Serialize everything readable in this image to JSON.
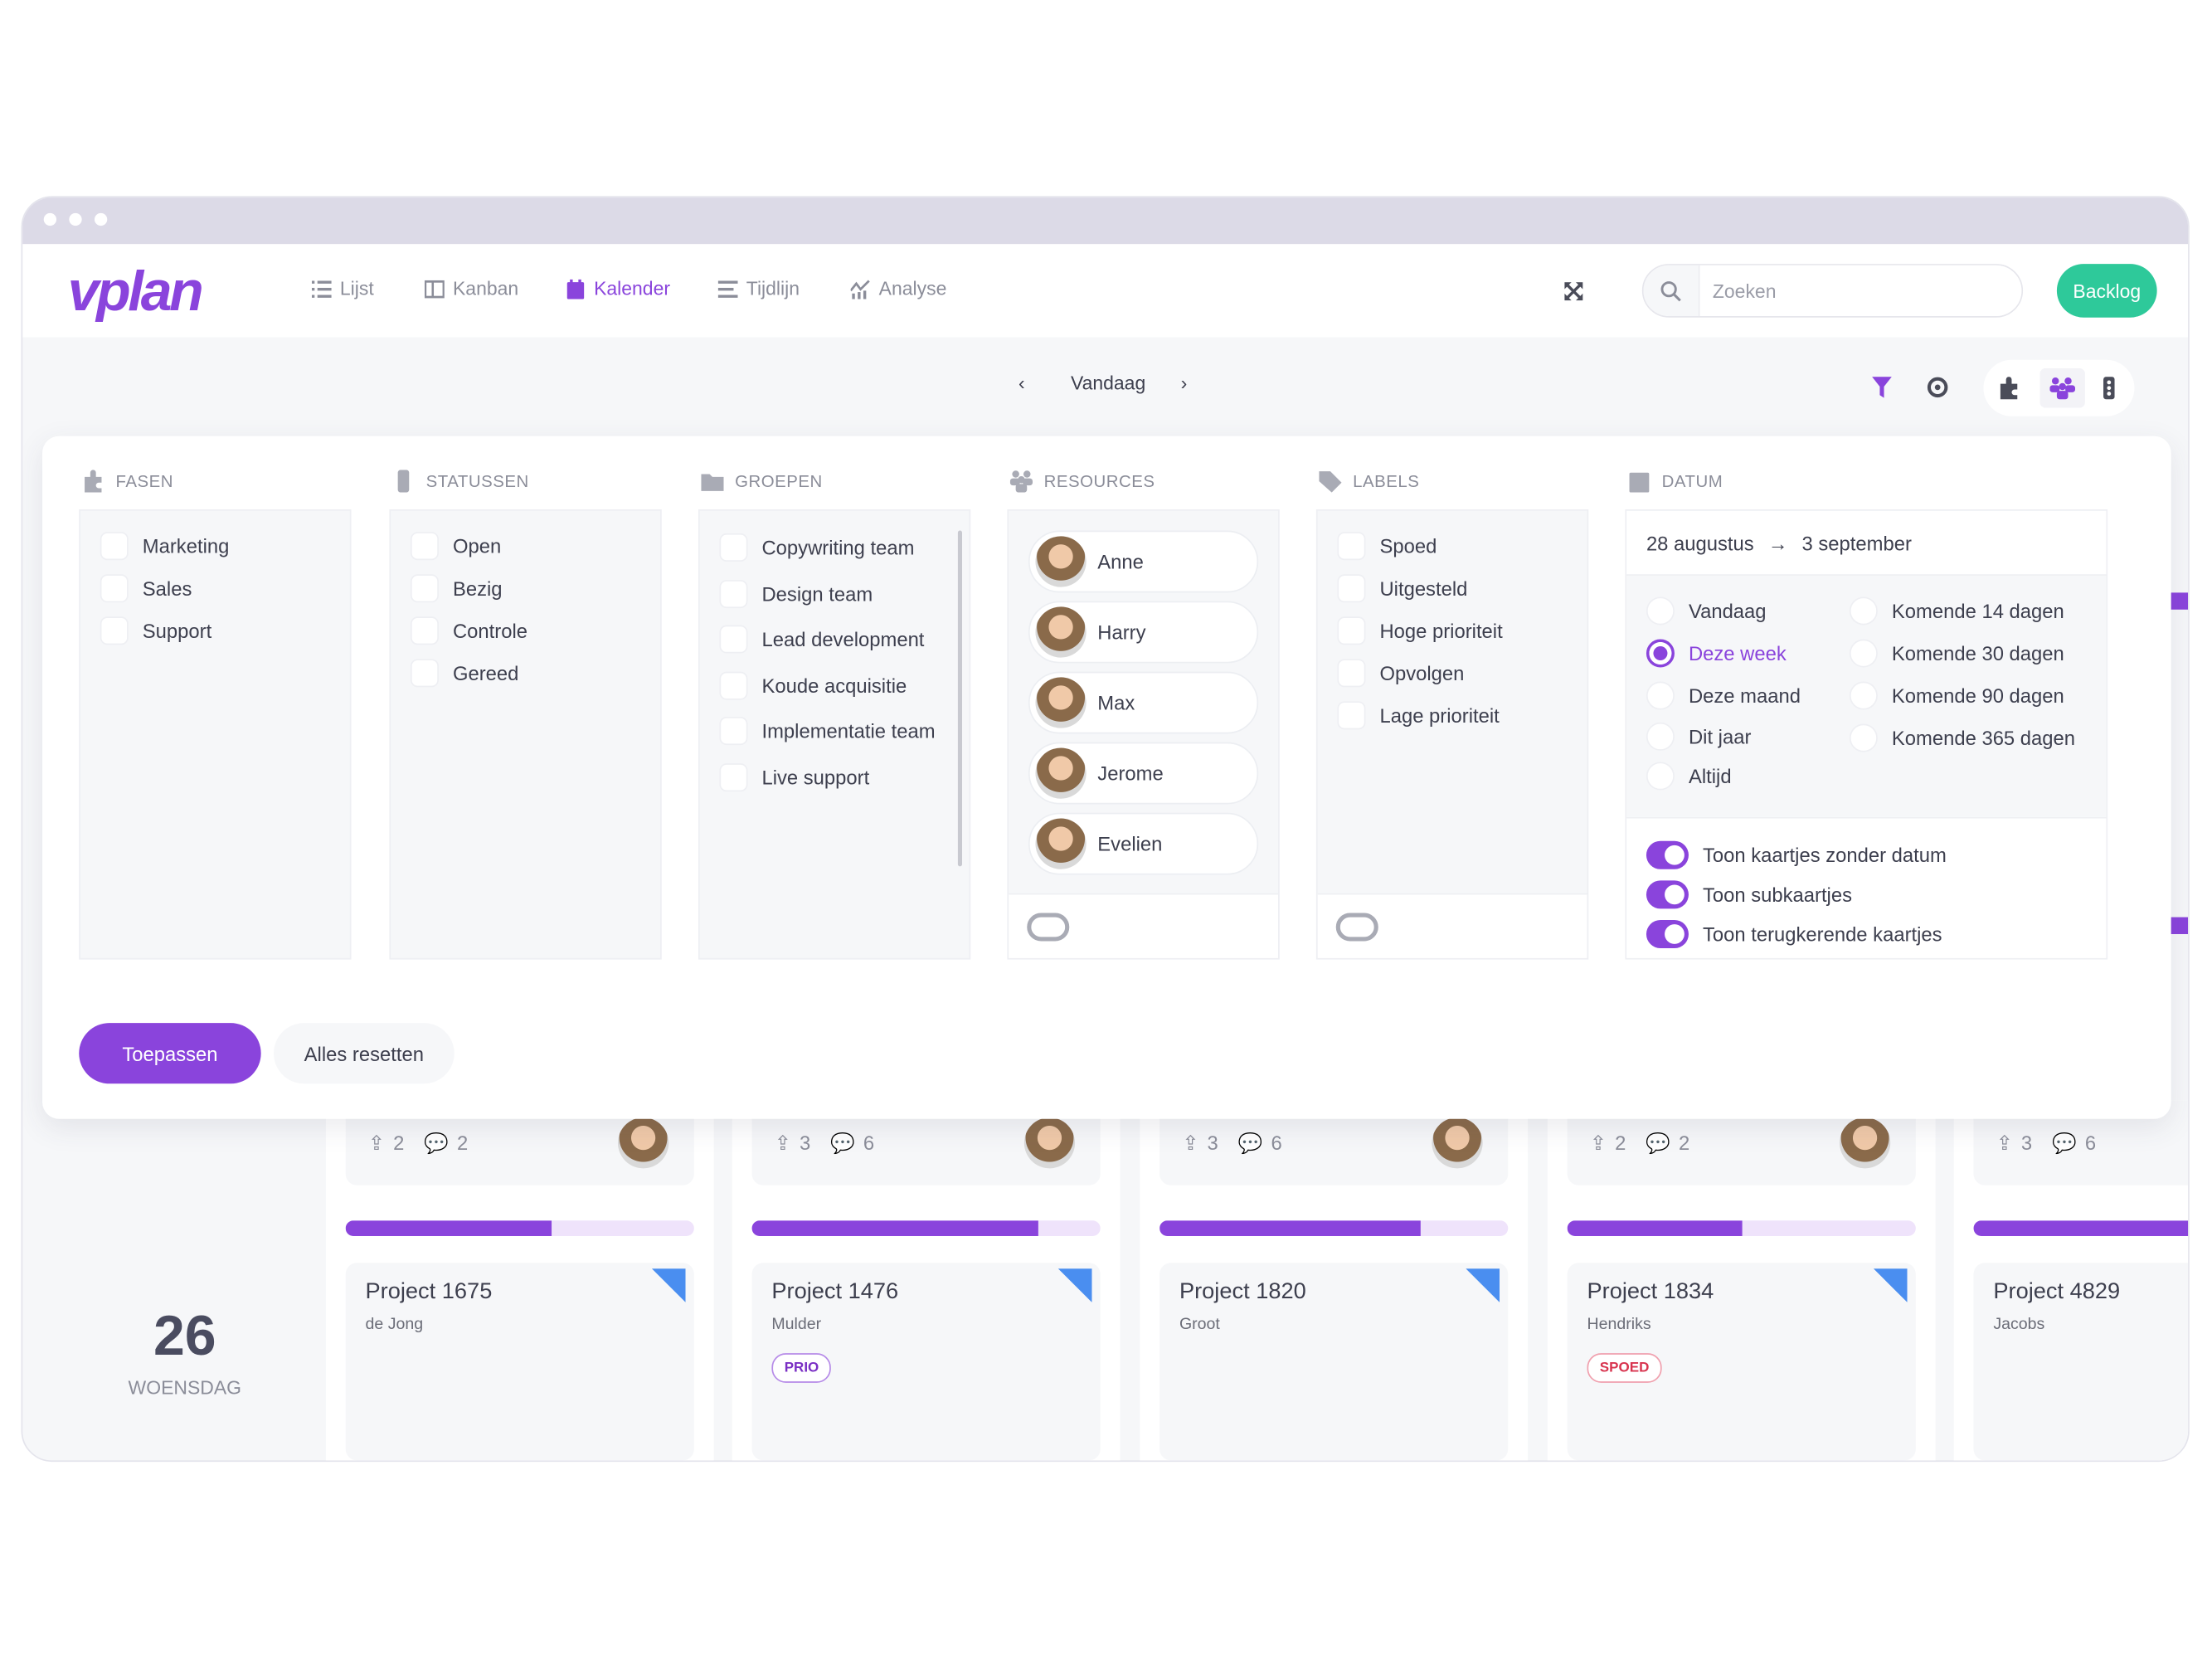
{
  "app": {
    "logo": "vplan"
  },
  "nav": [
    {
      "label": "Lijst",
      "icon": "list-icon"
    },
    {
      "label": "Kanban",
      "icon": "kanban-icon"
    },
    {
      "label": "Kalender",
      "icon": "calendar-icon",
      "active": true
    },
    {
      "label": "Tijdlijn",
      "icon": "timeline-icon"
    },
    {
      "label": "Analyse",
      "icon": "chart-icon"
    }
  ],
  "search": {
    "placeholder": "Zoeken",
    "value": ""
  },
  "backlog_label": "Backlog",
  "datenav": {
    "today": "Vandaag"
  },
  "colors": {
    "accent": "#8a44dc",
    "backlog": "#2ec99a",
    "flag": "#4a8ef0",
    "spoed": "#d8344f"
  },
  "filters": {
    "fasen": {
      "title": "FASEN",
      "items": [
        "Marketing",
        "Sales",
        "Support"
      ]
    },
    "statussen": {
      "title": "STATUSSEN",
      "items": [
        "Open",
        "Bezig",
        "Controle",
        "Gereed"
      ]
    },
    "groepen": {
      "title": "GROEPEN",
      "items": [
        "Copywriting team",
        "Design team",
        "Lead development",
        "Koude acquisitie",
        "Implementatie team",
        "Live support"
      ]
    },
    "resources": {
      "title": "RESOURCES",
      "items": [
        "Anne",
        "Harry",
        "Max",
        "Jerome",
        "Evelien"
      ],
      "toggle": false
    },
    "labels": {
      "title": "LABELS",
      "items": [
        "Spoed",
        "Uitgesteld",
        "Hoge prioriteit",
        "Opvolgen",
        "Lage prioriteit"
      ],
      "toggle": false
    },
    "datum": {
      "title": "DATUM",
      "from": "28 augustus",
      "arrow": "→",
      "to": "3 september",
      "options_left": [
        "Vandaag",
        "Deze week",
        "Deze maand",
        "Dit jaar",
        "Altijd"
      ],
      "options_right": [
        "Komende 14 dagen",
        "Komende 30 dagen",
        "Komende 90 dagen",
        "Komende 365 dagen"
      ],
      "selected": "Deze week",
      "toggles": [
        {
          "label": "Toon kaartjes zonder datum",
          "on": true
        },
        {
          "label": "Toon subkaartjes",
          "on": true
        },
        {
          "label": "Toon terugkerende kaartjes",
          "on": true
        }
      ]
    }
  },
  "actions": {
    "apply": "Toepassen",
    "reset": "Alles resetten"
  },
  "day": {
    "number": "26",
    "weekday": "WOENSDAG"
  },
  "cards": [
    {
      "uploads": "2",
      "comments": "2",
      "progress": 59,
      "title": "Project 1675",
      "client": "de Jong",
      "badge": "",
      "flag": true
    },
    {
      "uploads": "3",
      "comments": "6",
      "progress": 82,
      "title": "Project 1476",
      "client": "Mulder",
      "badge": "PRIO",
      "flag": true
    },
    {
      "uploads": "3",
      "comments": "6",
      "progress": 75,
      "title": "Project 1820",
      "client": "Groot",
      "badge": "",
      "flag": true
    },
    {
      "uploads": "2",
      "comments": "2",
      "progress": 50,
      "title": "Project 1834",
      "client": "Hendriks",
      "badge": "SPOED",
      "flag": true
    },
    {
      "uploads": "3",
      "comments": "6",
      "progress": 100,
      "title": "Project 4829",
      "client": "Jacobs",
      "badge": "",
      "flag": false
    }
  ]
}
